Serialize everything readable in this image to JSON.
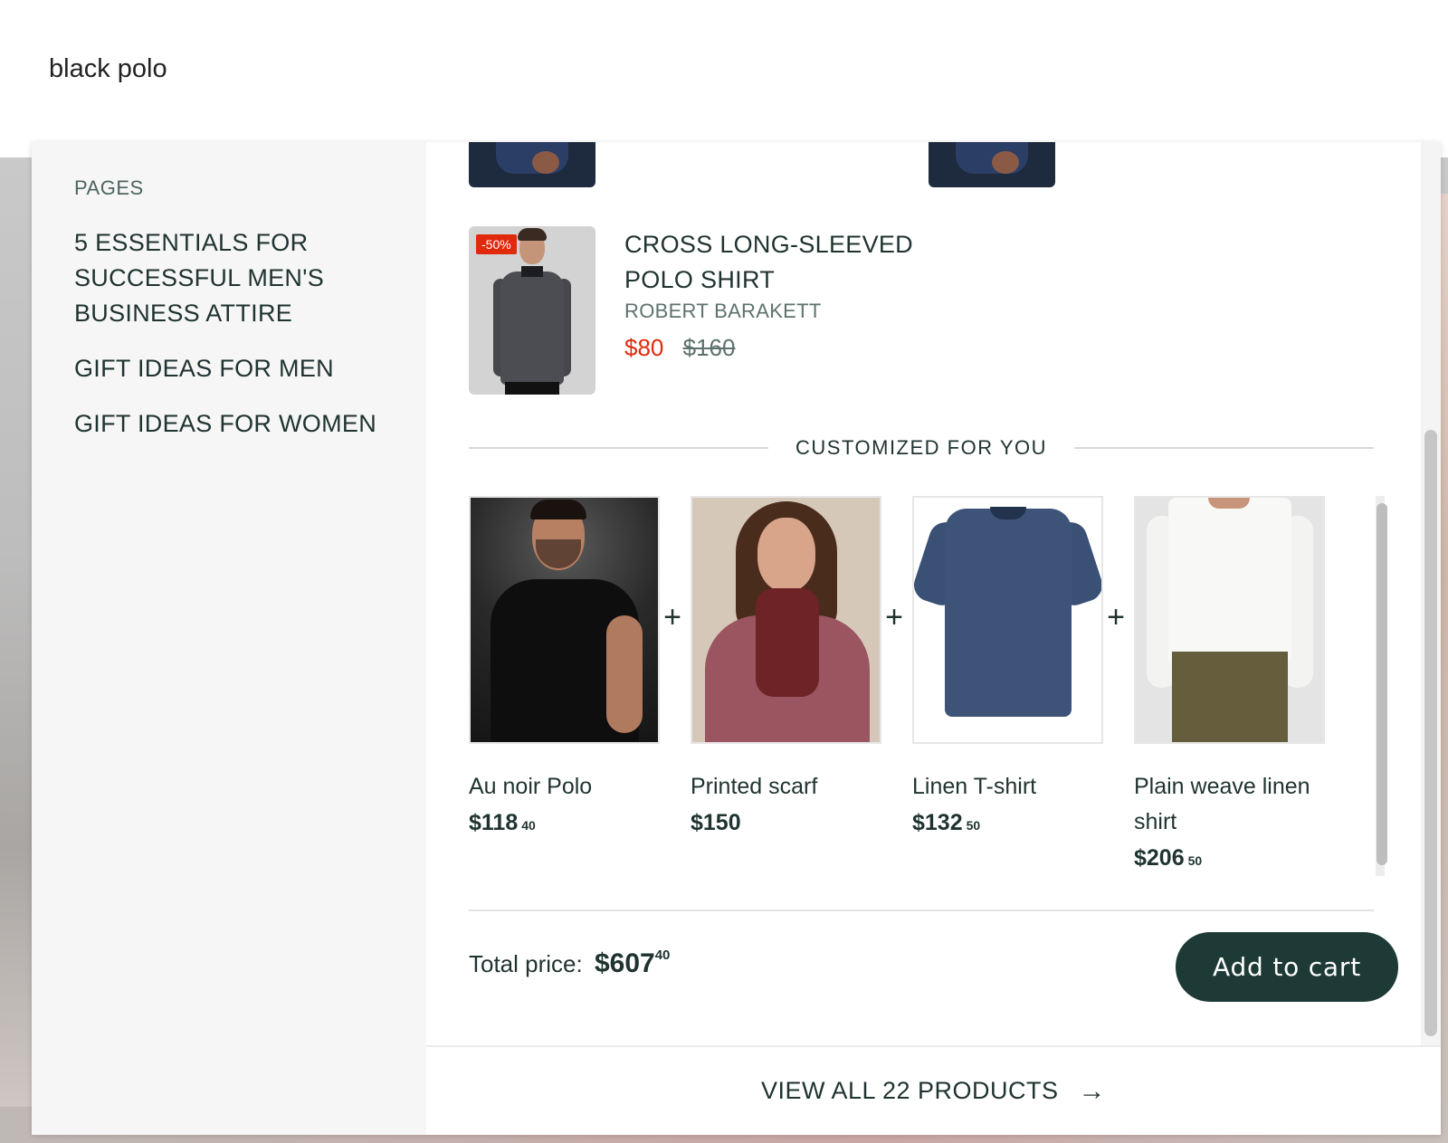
{
  "search": {
    "query": "black polo"
  },
  "sidebar": {
    "heading": "PAGES",
    "pages": [
      "5 ESSENTIALS FOR SUCCESSFUL MEN'S BUSINESS ATTIRE",
      "GIFT IDEAS FOR MEN",
      "GIFT IDEAS FOR WOMEN"
    ]
  },
  "product": {
    "badge": "-50%",
    "name_line1": "CROSS LONG-SLEEVED",
    "name_line2": "POLO SHIRT",
    "brand": "ROBERT BARAKETT",
    "price_sale": "$80",
    "price_old": "$160"
  },
  "customized": {
    "title": "CUSTOMIZED FOR YOU",
    "items": [
      {
        "name": "Au noir Polo",
        "price": "$118",
        "cents": "40"
      },
      {
        "name": "Printed scarf",
        "price": "$150",
        "cents": ""
      },
      {
        "name": "Linen T-shirt",
        "price": "$132",
        "cents": "50"
      },
      {
        "name": "Plain weave linen shirt",
        "price": "$206",
        "cents": "50"
      }
    ],
    "total_label": "Total price:",
    "total_value": "$607",
    "total_cents": "40",
    "add_to_cart": "Add to cart"
  },
  "footer": {
    "view_all": "VIEW ALL 22 PRODUCTS"
  },
  "colors": {
    "accent": "#1e3a36",
    "sale": "#e1290c",
    "text": "#1f3330"
  }
}
